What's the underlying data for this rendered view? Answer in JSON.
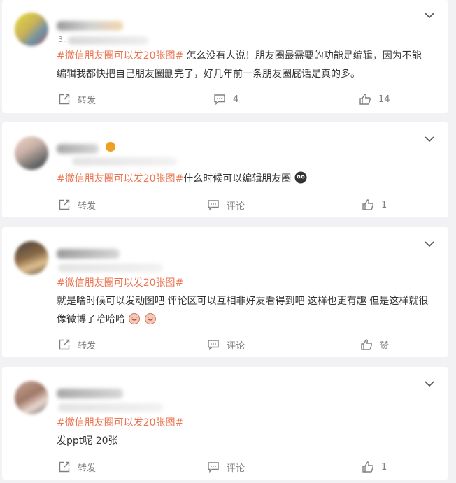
{
  "posts": [
    {
      "topic": "#微信朋友圈可以发20张图#",
      "text": " 怎么没有人说！朋友圈最需要的功能是编辑，因为不能编辑我都快把自己朋友圈删完了，好几年前一条朋友圈屁话是真的多。",
      "forward_label": "转发",
      "comment_label": "4",
      "like_label": "14",
      "meta_prefix": "3."
    },
    {
      "topic": "#微信朋友圈可以发20张图#",
      "text": "什么时候可以编辑朋友圈",
      "forward_label": "转发",
      "comment_label": "评论",
      "like_label": "1"
    },
    {
      "topic": "#微信朋友圈可以发20张图#",
      "text": "就是啥时候可以发动图吧 评论区可以互相非好友看得到吧 这样也更有趣 但是这样就很像微博了哈哈哈",
      "forward_label": "转发",
      "comment_label": "评论",
      "like_label": "赞"
    },
    {
      "topic": "#微信朋友圈可以发20张图#",
      "text": "发ppt呢 20张",
      "forward_label": "转发",
      "comment_label": "评论",
      "like_label": "1"
    }
  ],
  "icons": {
    "forward": "forward-icon",
    "comment": "comment-icon",
    "like": "like-icon",
    "menu": "chevron-down-icon"
  },
  "colors": {
    "topic": "#eb7350",
    "text": "#333333",
    "action": "#808080",
    "background": "#f2f2f5"
  }
}
